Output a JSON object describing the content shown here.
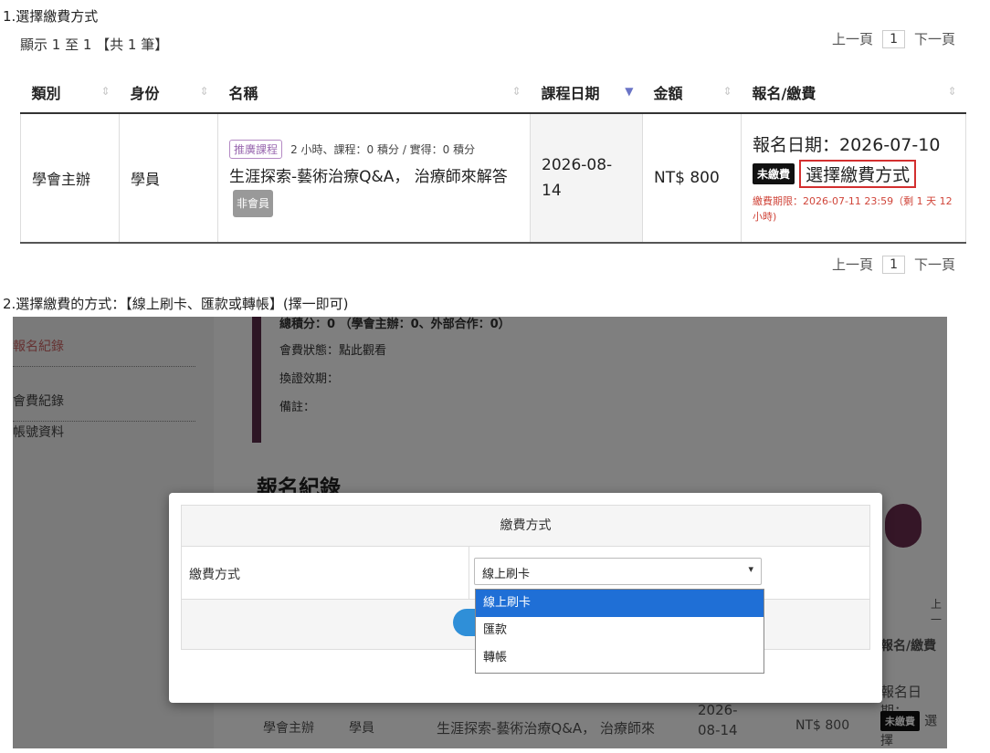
{
  "step1": {
    "title": "1.選擇繳費方式",
    "count": "顯示 1 至 1 【共 1 筆】",
    "pager_top": {
      "prev": "上一頁",
      "page": "1",
      "next": "下一頁"
    },
    "table": {
      "headers": {
        "category": "類別",
        "identity": "身份",
        "name": "名稱",
        "date": "課程日期",
        "amount": "金額",
        "signup": "報名/繳費"
      },
      "row": {
        "category": "學會主辦",
        "identity": "學員",
        "promo_tag": "推廣課程",
        "meta": "2 小時、課程：0 積分 / 實得：0 積分",
        "course_name": "生涯探索-藝術治療Q&A， 治療師來解答",
        "member_tag": "非會員",
        "course_date": "2026-08-14",
        "amount": "NT$ 800",
        "signup_date": "報名日期：2026-07-10",
        "unpaid_badge": "未繳費",
        "pay_link": "選擇繳費方式",
        "deadline": "繳費期限：2026-07-11 23:59（剩 1 天 12 小時)"
      }
    },
    "pager_bottom": {
      "prev": "上一頁",
      "page": "1",
      "next": "下一頁"
    }
  },
  "step2": {
    "title": "2.選擇繳費的方式：【線上刷卡、匯款或轉帳】(擇一即可)",
    "sidebar": [
      "報名紀錄",
      "會費紀錄",
      "帳號資料"
    ],
    "info": {
      "credits": "總積分：0 （學會主辦：0、外部合作：0）",
      "fee_status": "會費狀態：點此觀看",
      "renewal": "換證效期：",
      "note": "備註："
    },
    "section_title": "報名紀錄",
    "modal": {
      "title": "繳費方式",
      "label": "繳費方式",
      "selected": "線上刷卡",
      "options": [
        "線上刷卡",
        "匯款",
        "轉帳"
      ]
    },
    "bg_row": {
      "category": "學會主辦",
      "identity": "學員",
      "course_name": "生涯探索-藝術治療Q&A， 治療師來",
      "date": "2026-08-14",
      "amount": "NT$ 800",
      "unpaid": "未繳費",
      "pay": "選擇",
      "signup_header": "報名/繳費",
      "signup_date": "報名日期：",
      "page": "上一"
    }
  }
}
